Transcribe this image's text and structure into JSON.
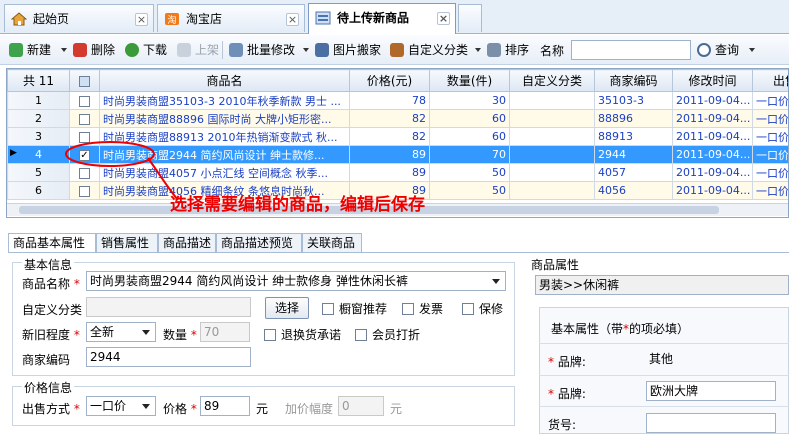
{
  "tabs": [
    {
      "label": "起始页",
      "icon": "home-icon"
    },
    {
      "label": "淘宝店",
      "icon": "taobao-icon"
    },
    {
      "label": "待上传新商品",
      "icon": "product-list-icon"
    }
  ],
  "toolbar": {
    "new": "新建",
    "delete": "删除",
    "download": "下载",
    "publish": "上架",
    "batch_edit": "批量修改",
    "image_move": "图片搬家",
    "custom_category": "自定义分类",
    "sort": "排序",
    "name_label": "名称",
    "name_value": "",
    "query": "查询"
  },
  "grid": {
    "count_header": "共 11",
    "columns": [
      "商品名",
      "价格(元)",
      "数量(件)",
      "自定义分类",
      "商家编码",
      "修改时间",
      "出售"
    ],
    "rows": [
      {
        "idx": "1",
        "name": "时尚男装商盟35103-3 2010年秋季新款 男士 ...",
        "price": "78",
        "qty": "30",
        "cat": "",
        "code": "35103-3",
        "time": "2011-09-04...",
        "sale": "一口价",
        "checked": false
      },
      {
        "idx": "2",
        "name": "时尚男装商盟88896 国际时尚 大牌小矩形密...",
        "price": "82",
        "qty": "60",
        "cat": "",
        "code": "88896",
        "time": "2011-09-04...",
        "sale": "一口价",
        "checked": false
      },
      {
        "idx": "3",
        "name": "时尚男装商盟88913 2010年热销渐变款式 秋...",
        "price": "82",
        "qty": "60",
        "cat": "",
        "code": "88913",
        "time": "2011-09-04...",
        "sale": "一口价",
        "checked": false
      },
      {
        "idx": "4",
        "name": "时尚男装商盟2944 简约风尚设计 绅士款修...",
        "price": "89",
        "qty": "70",
        "cat": "",
        "code": "2944",
        "time": "2011-09-04...",
        "sale": "一口价",
        "checked": true
      },
      {
        "idx": "5",
        "name": "时尚男装商盟4057 小点汇线 空间概念 秋季...",
        "price": "89",
        "qty": "50",
        "cat": "",
        "code": "4057",
        "time": "2011-09-04...",
        "sale": "一口价",
        "checked": false
      },
      {
        "idx": "6",
        "name": "时尚男装商盟4056 精细条纹 条悠息时尚秋...",
        "price": "89",
        "qty": "50",
        "cat": "",
        "code": "4056",
        "time": "2011-09-04...",
        "sale": "一口价",
        "checked": false
      }
    ]
  },
  "annotation": "选择需要编辑的商品，编辑后保存",
  "bottom_tabs": [
    "商品基本属性",
    "销售属性",
    "商品描述",
    "商品描述预览",
    "关联商品"
  ],
  "basic": {
    "section_title": "基本信息",
    "name_label": "商品名称",
    "name_value": "时尚男装商盟2944 简约风尚设计 绅士款修身 弹性休闲长裤",
    "custom_cat_label": "自定义分类",
    "select_btn": "选择",
    "window_rec": "橱窗推荐",
    "invoice": "发票",
    "warranty": "保修",
    "condition_label": "新旧程度",
    "condition_value": "全新",
    "qty_label": "数量",
    "qty_value": "70",
    "return_promise": "退换货承诺",
    "member_discount": "会员打折",
    "code_label": "商家编码",
    "code_value": "2944"
  },
  "price": {
    "section_title": "价格信息",
    "sale_method_label": "出售方式",
    "sale_method_value": "一口价",
    "price_label": "价格",
    "price_value": "89",
    "unit": "元",
    "raise_label": "加价幅度",
    "raise_value": "0",
    "raise_unit": "元"
  },
  "right": {
    "attr_title": "商品属性",
    "category_value": "男装>>休闲裤",
    "basic_attr_title": "基本属性（带",
    "basic_attr_star": "*",
    "basic_attr_tail": "的项必填）",
    "rows": [
      {
        "label": "品牌:",
        "required": "*",
        "value": "其他"
      },
      {
        "label": "品牌:",
        "required": "*",
        "value": "欧洲大牌"
      },
      {
        "label": "货号:",
        "required": "",
        "value": ""
      }
    ]
  },
  "colors": {
    "selection": "#3399ff",
    "link_blue": "#1a3fc4",
    "annotation_red": "#e00000"
  }
}
